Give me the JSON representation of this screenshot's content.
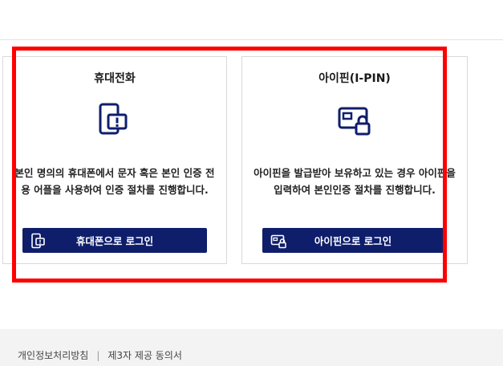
{
  "phone_card": {
    "title": "휴대전화",
    "description": "본인 명의의 휴대폰에서 문자 혹은 본인 인증 전용 어플을 사용하여 인증 절차를 진행합니다.",
    "button_label": "휴대폰으로 로그인",
    "icon": "mobile-phone-alert-icon"
  },
  "ipin_card": {
    "title": "아이핀(I-PIN)",
    "description": "아이핀을 발급받아 보유하고 있는 경우 아이핀을 입력하여 본인인증 절차를 진행합니다.",
    "button_label": "아이핀으로 로그인",
    "icon": "id-card-lock-icon"
  },
  "footer": {
    "privacy_policy": "개인정보처리방침",
    "separator": "|",
    "third_party_consent": "제3자 제공 동의서"
  },
  "colors": {
    "button_bg": "#0f1e6b",
    "icon_stroke": "#0f1e6b",
    "highlight": "#ff0000",
    "footer_bg": "#f3f3f3"
  }
}
